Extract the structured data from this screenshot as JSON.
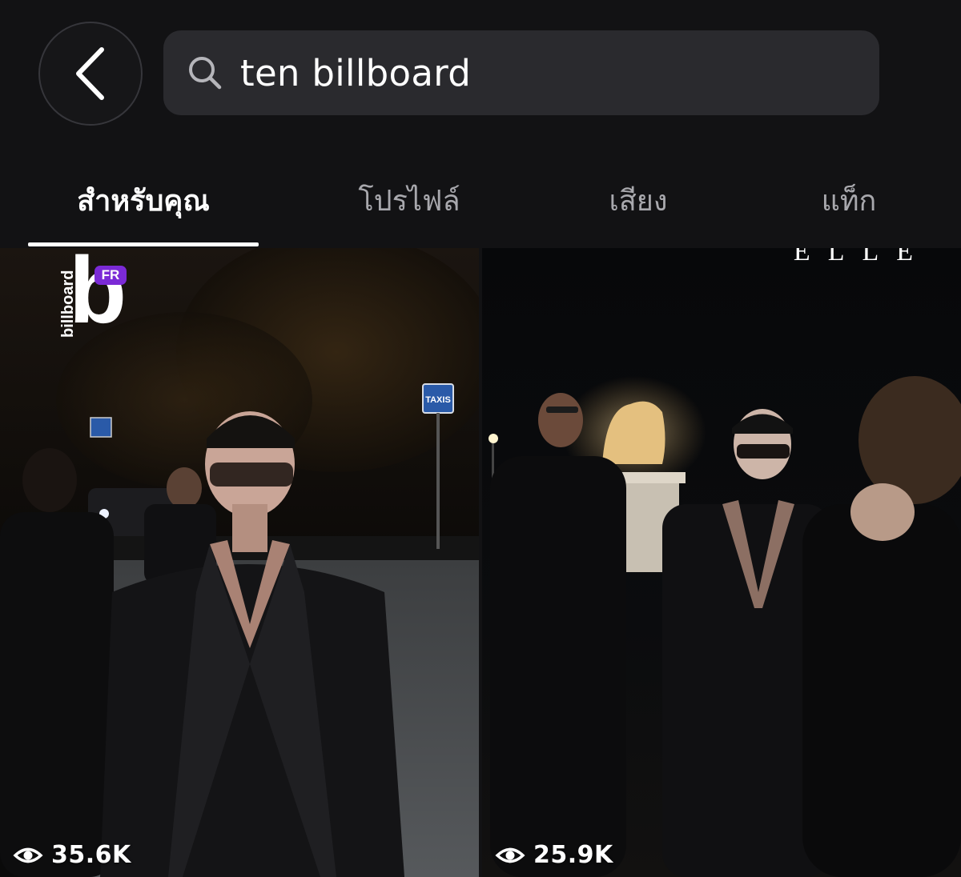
{
  "search": {
    "query": "ten billboard"
  },
  "tabs": [
    {
      "label": "สำหรับคุณ",
      "active": true
    },
    {
      "label": "โปรไฟล์",
      "active": false
    },
    {
      "label": "เสียง",
      "active": false
    },
    {
      "label": "แท็ก",
      "active": false
    }
  ],
  "results": [
    {
      "views": "35.6K",
      "logo": {
        "word": "billboard",
        "letter": "b",
        "badge": "FR"
      },
      "sign_text": "TAXIS"
    },
    {
      "views": "25.9K",
      "logo": {
        "word": "ELLE"
      }
    }
  ],
  "colors": {
    "background": "#121214",
    "search_field": "#2a2a2e",
    "tab_inactive": "#a8a8ad",
    "badge_purple": "#7b2ad6"
  },
  "icons": [
    "back-chevron-icon",
    "search-icon",
    "eye-icon"
  ]
}
